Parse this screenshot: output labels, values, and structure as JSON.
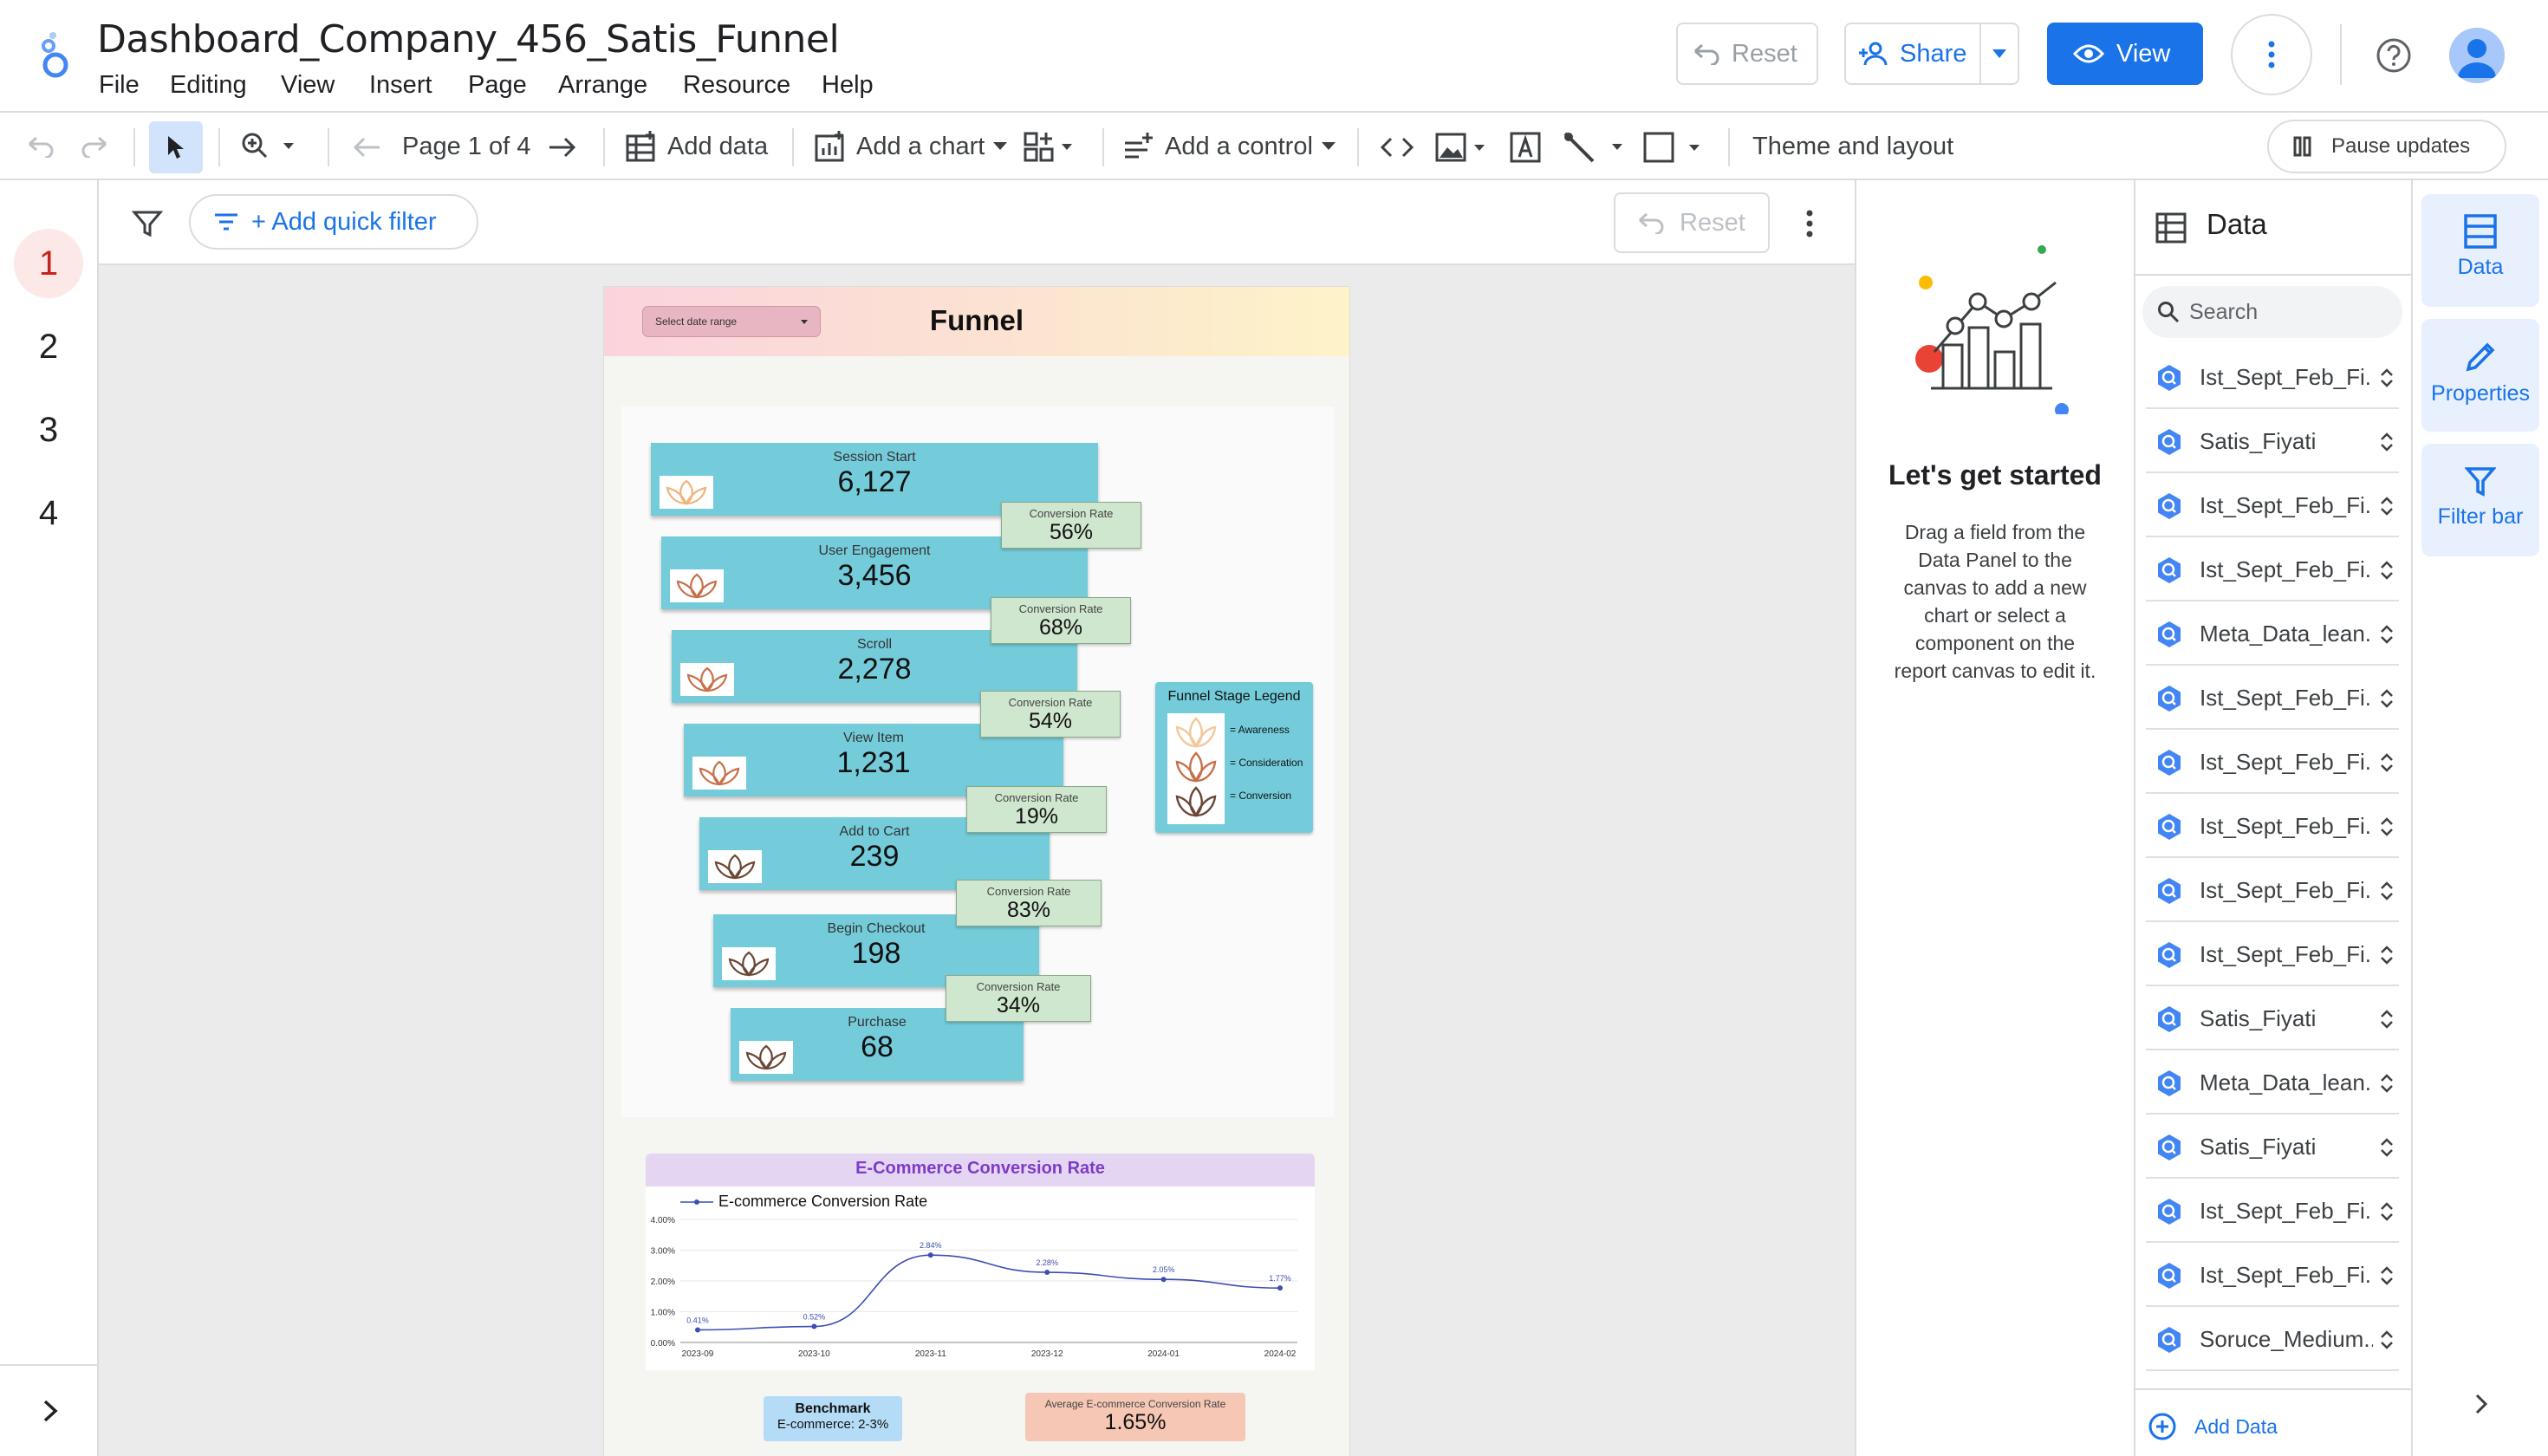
{
  "app": {
    "title": "Dashboard_Company_456_Satis_Funnel",
    "menu": [
      "File",
      "Editing",
      "View",
      "Insert",
      "Page",
      "Arrange",
      "Resource",
      "Help"
    ],
    "reset_label": "Reset",
    "share_label": "Share",
    "view_label": "View",
    "accent": "#1a73e8"
  },
  "toolbar": {
    "page_indicator": "Page 1 of 4",
    "add_data": "Add data",
    "add_chart": "Add a chart",
    "add_control": "Add a control",
    "theme": "Theme and layout",
    "pause": "Pause updates"
  },
  "pages": [
    "1",
    "2",
    "3",
    "4"
  ],
  "filterbar": {
    "add_filter": "+ Add quick filter",
    "reset": "Reset"
  },
  "report": {
    "date_range": "Select date range",
    "title": "Funnel",
    "stages": [
      {
        "label": "Session Start",
        "value": "6,127",
        "tier": "awareness"
      },
      {
        "label": "User Engagement",
        "value": "3,456",
        "tier": "consideration"
      },
      {
        "label": "Scroll",
        "value": "2,278",
        "tier": "consideration"
      },
      {
        "label": "View Item",
        "value": "1,231",
        "tier": "consideration"
      },
      {
        "label": "Add to Cart",
        "value": "239",
        "tier": "conversion"
      },
      {
        "label": "Begin Checkout",
        "value": "198",
        "tier": "conversion"
      },
      {
        "label": "Purchase",
        "value": "68",
        "tier": "conversion"
      }
    ],
    "conversion_label": "Conversion Rate",
    "conversion_rates": [
      "56%",
      "68%",
      "54%",
      "19%",
      "83%",
      "34%"
    ],
    "legend": {
      "title": "Funnel Stage Legend",
      "items": [
        "= Awareness",
        "= Consideration",
        "= Conversion"
      ],
      "colors": {
        "awareness": "#f3c79a",
        "consideration": "#c8704a",
        "conversion": "#6b4634"
      }
    },
    "ecommerce_header": "E-Commerce Conversion Rate",
    "benchmark": {
      "title": "Benchmark",
      "text": "E-commerce: 2-3%"
    },
    "average": {
      "title": "Average E-commerce Conversion Rate",
      "value": "1.65%"
    }
  },
  "chart_data": {
    "type": "line",
    "title": "",
    "xlabel": "",
    "ylabel": "",
    "x": [
      "2023-09",
      "2023-10",
      "2023-11",
      "2023-12",
      "2024-01",
      "2024-02"
    ],
    "series": [
      {
        "name": "E-commerce Conversion Rate",
        "values": [
          0.41,
          0.52,
          2.84,
          2.28,
          2.05,
          1.77
        ],
        "labels": [
          "0.41%",
          "0.52%",
          "2.84%",
          "2.28%",
          "2.05%",
          "1.77%"
        ],
        "color": "#3b4fb0"
      }
    ],
    "y_ticks": [
      "4.00%",
      "3.00%",
      "2.00%",
      "1.00%",
      "0.00%"
    ],
    "ylim": [
      0,
      4
    ],
    "grid": true,
    "legend": "top-left"
  },
  "started": {
    "title": "Let's get started",
    "body": "Drag a field from the Data Panel to the canvas to add a new chart or select a component on the report canvas to edit it."
  },
  "data_panel": {
    "title": "Data",
    "search_placeholder": "Search",
    "sources": [
      "Ist_Sept_Feb_Fi...",
      "Satis_Fiyati",
      "Ist_Sept_Feb_Fi...",
      "Ist_Sept_Feb_Fi...",
      "Meta_Data_lean...",
      "Ist_Sept_Feb_Fi...",
      "Ist_Sept_Feb_Fi...",
      "Ist_Sept_Feb_Fi...",
      "Ist_Sept_Feb_Fi...",
      "Ist_Sept_Feb_Fi...",
      "Satis_Fiyati",
      "Meta_Data_lean...",
      "Satis_Fiyati",
      "Ist_Sept_Feb_Fi...",
      "Ist_Sept_Feb_Fi...",
      "Soruce_Medium..."
    ],
    "add_data": "Add Data"
  },
  "side_tabs": [
    "Data",
    "Properties",
    "Filter bar"
  ]
}
